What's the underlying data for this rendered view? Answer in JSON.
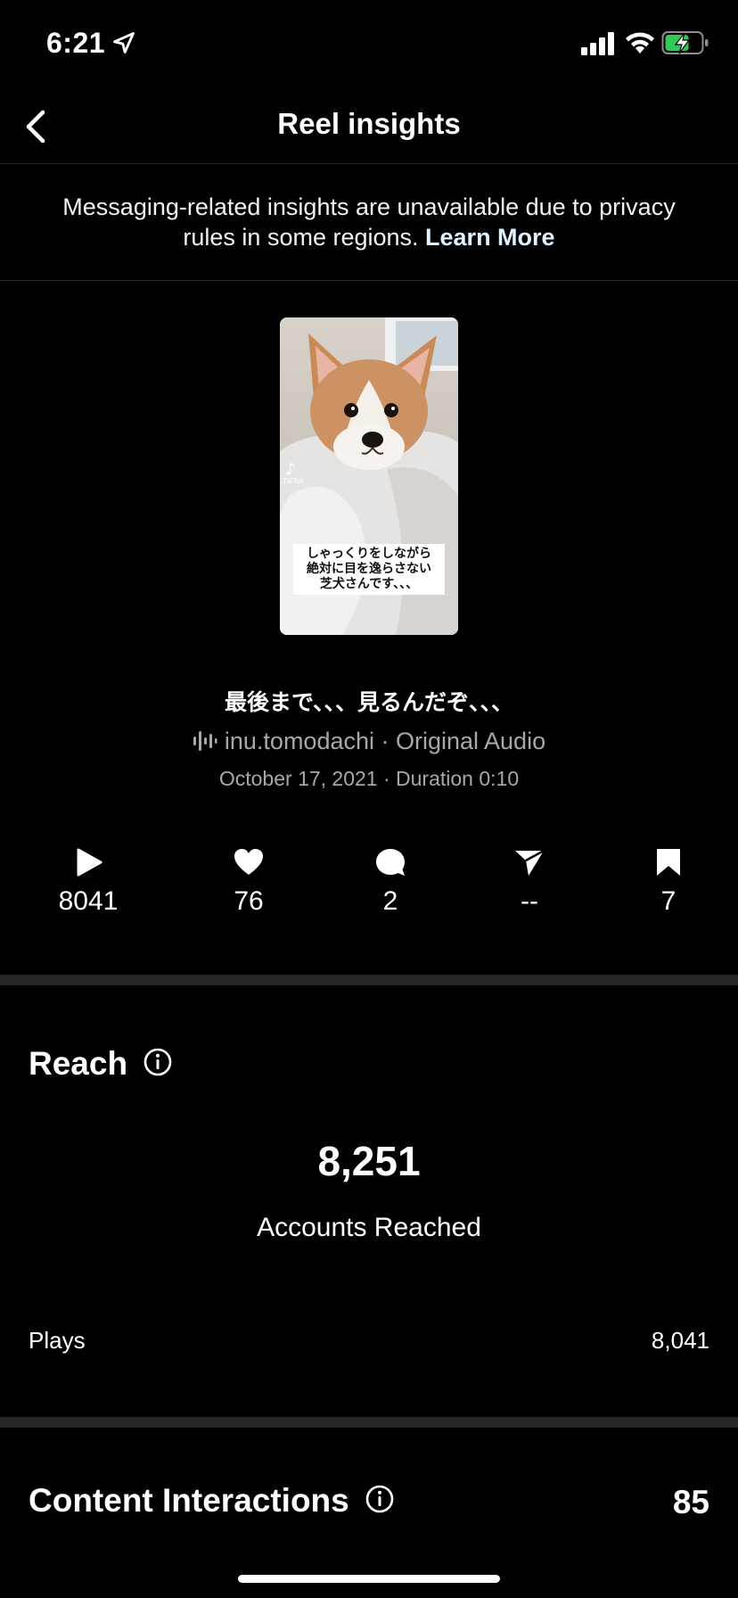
{
  "status_bar": {
    "time": "6:21"
  },
  "header": {
    "title": "Reel insights"
  },
  "notice": {
    "text": "Messaging-related insights are unavailable due to privacy rules in some regions. ",
    "link": "Learn More"
  },
  "thumbnail": {
    "watermark": "TikTok",
    "overlay_lines": [
      "しゃっくりをしながら",
      "絶対に目を逸らさない",
      "芝犬さんです、、、"
    ]
  },
  "reel": {
    "caption": "最後まで、、、見るんだぞ、、、",
    "audio": "inu.tomodachi · Original Audio",
    "date": "October 17, 2021 · Duration 0:10"
  },
  "stats": {
    "plays": "8041",
    "likes": "76",
    "comments": "2",
    "shares": "--",
    "saves": "7"
  },
  "reach": {
    "title": "Reach",
    "accounts_reached_value": "8,251",
    "accounts_reached_label": "Accounts Reached",
    "plays_label": "Plays",
    "plays_value": "8,041"
  },
  "content_interactions": {
    "title": "Content Interactions",
    "value": "85"
  },
  "colors": {
    "background": "#000000",
    "divider": "#262626",
    "secondary_text": "#a8a8a8",
    "battery_green": "#34c759"
  }
}
